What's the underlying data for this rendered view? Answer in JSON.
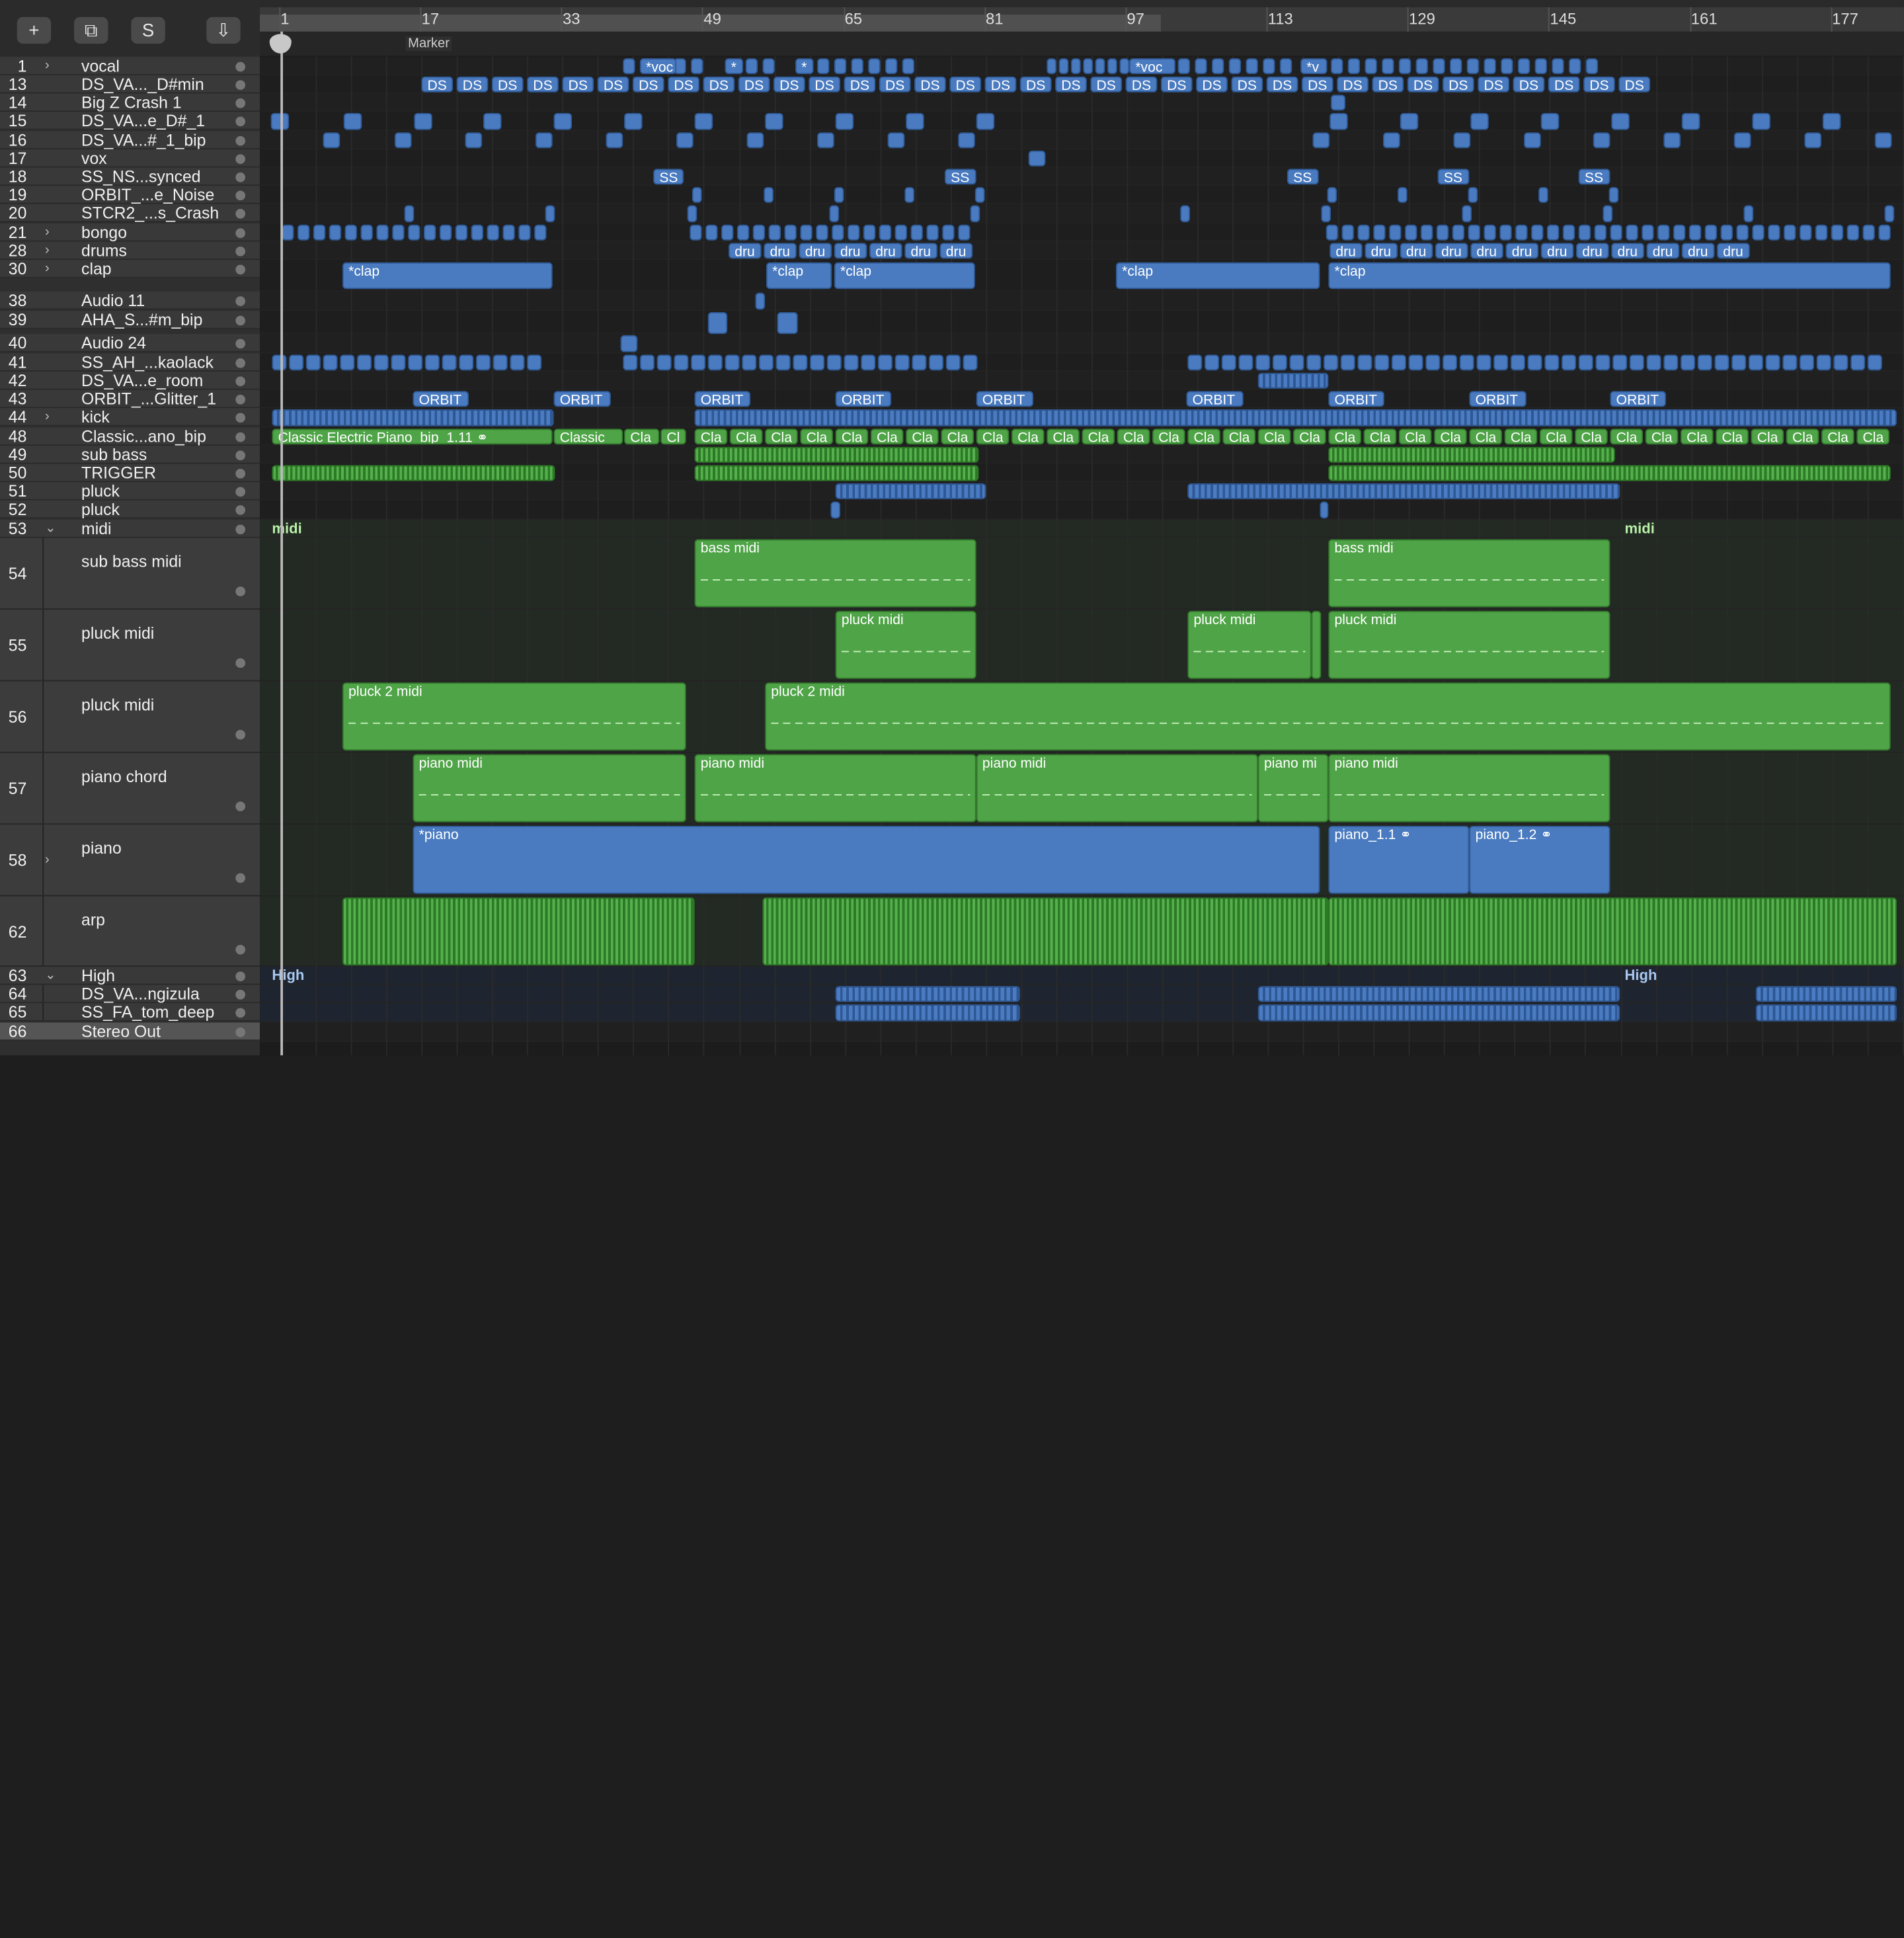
{
  "toolbar": {
    "add_label": "+",
    "duplicate_label": "⧉",
    "solo_label": "S",
    "download_label": "⇩"
  },
  "ruler": {
    "bars": [
      "1",
      "17",
      "33",
      "49",
      "65",
      "81",
      "97",
      "113",
      "129",
      "145",
      "161",
      "177"
    ],
    "marker_label": "Marker"
  },
  "tracks": [
    {
      "num": "1",
      "name": "vocal",
      "disclosure": "›"
    },
    {
      "num": "13",
      "name": "DS_VA..._D#min"
    },
    {
      "num": "14",
      "name": "Big Z Crash 1"
    },
    {
      "num": "15",
      "name": "DS_VA...e_D#_1"
    },
    {
      "num": "16",
      "name": "DS_VA...#_1_bip"
    },
    {
      "num": "17",
      "name": "vox"
    },
    {
      "num": "18",
      "name": "SS_NS...synced"
    },
    {
      "num": "19",
      "name": "ORBIT_...e_Noise"
    },
    {
      "num": "20",
      "name": "STCR2_...s_Crash"
    },
    {
      "num": "21",
      "name": "bongo",
      "disclosure": "›"
    },
    {
      "num": "28",
      "name": "drums",
      "disclosure": "›"
    },
    {
      "num": "30",
      "name": "clap",
      "disclosure": "›"
    },
    {
      "num": "38",
      "name": "Audio 11"
    },
    {
      "num": "39",
      "name": "AHA_S...#m_bip"
    },
    {
      "num": "40",
      "name": "Audio 24"
    },
    {
      "num": "41",
      "name": "SS_AH_...kaolack"
    },
    {
      "num": "42",
      "name": "DS_VA...e_room"
    },
    {
      "num": "43",
      "name": "ORBIT_...Glitter_1"
    },
    {
      "num": "44",
      "name": "kick",
      "disclosure": "›"
    },
    {
      "num": "48",
      "name": "Classic...ano_bip"
    },
    {
      "num": "49",
      "name": "sub bass"
    },
    {
      "num": "50",
      "name": "TRIGGER"
    },
    {
      "num": "51",
      "name": "pluck"
    },
    {
      "num": "52",
      "name": "pluck"
    },
    {
      "num": "53",
      "name": "midi",
      "disclosure": "⌄"
    },
    {
      "num": "54",
      "name": "sub  bass midi"
    },
    {
      "num": "55",
      "name": "pluck midi"
    },
    {
      "num": "56",
      "name": "pluck midi"
    },
    {
      "num": "57",
      "name": "piano chord"
    },
    {
      "num": "58",
      "name": "piano",
      "disclosure": "›"
    },
    {
      "num": "62",
      "name": "arp"
    },
    {
      "num": "63",
      "name": "High",
      "disclosure": "⌄"
    },
    {
      "num": "64",
      "name": "DS_VA...ngizula"
    },
    {
      "num": "65",
      "name": "SS_FA_tom_deep"
    },
    {
      "num": "66",
      "name": "Stereo Out"
    }
  ],
  "regions": {
    "voc1": "*voc",
    "voc_star": "*",
    "voc2": "*voc",
    "voc3": "*v",
    "ds": "DS_",
    "ds_short": "DS",
    "ss": "SS",
    "dru": "dru",
    "clap": "*clap",
    "orbit": "ORBIT",
    "orbit_": "ORBIT_",
    "classic_full": "Classic Electric Piano_bip_1.11",
    "classic": "Classic",
    "cla": "Cla",
    "cl": "Cl",
    "midi_folder": "midi",
    "bass_midi": "bass midi",
    "pluck_midi": "pluck midi",
    "pluck2_midi": "pluck 2  midi",
    "piano_midi": "piano midi",
    "piano_mi": "piano mi",
    "piano": "*piano",
    "piano_1_1": "piano_1.1",
    "piano_1_2": "piano_1.2",
    "high_folder": "High",
    "loop_icon": "loop-icon"
  }
}
